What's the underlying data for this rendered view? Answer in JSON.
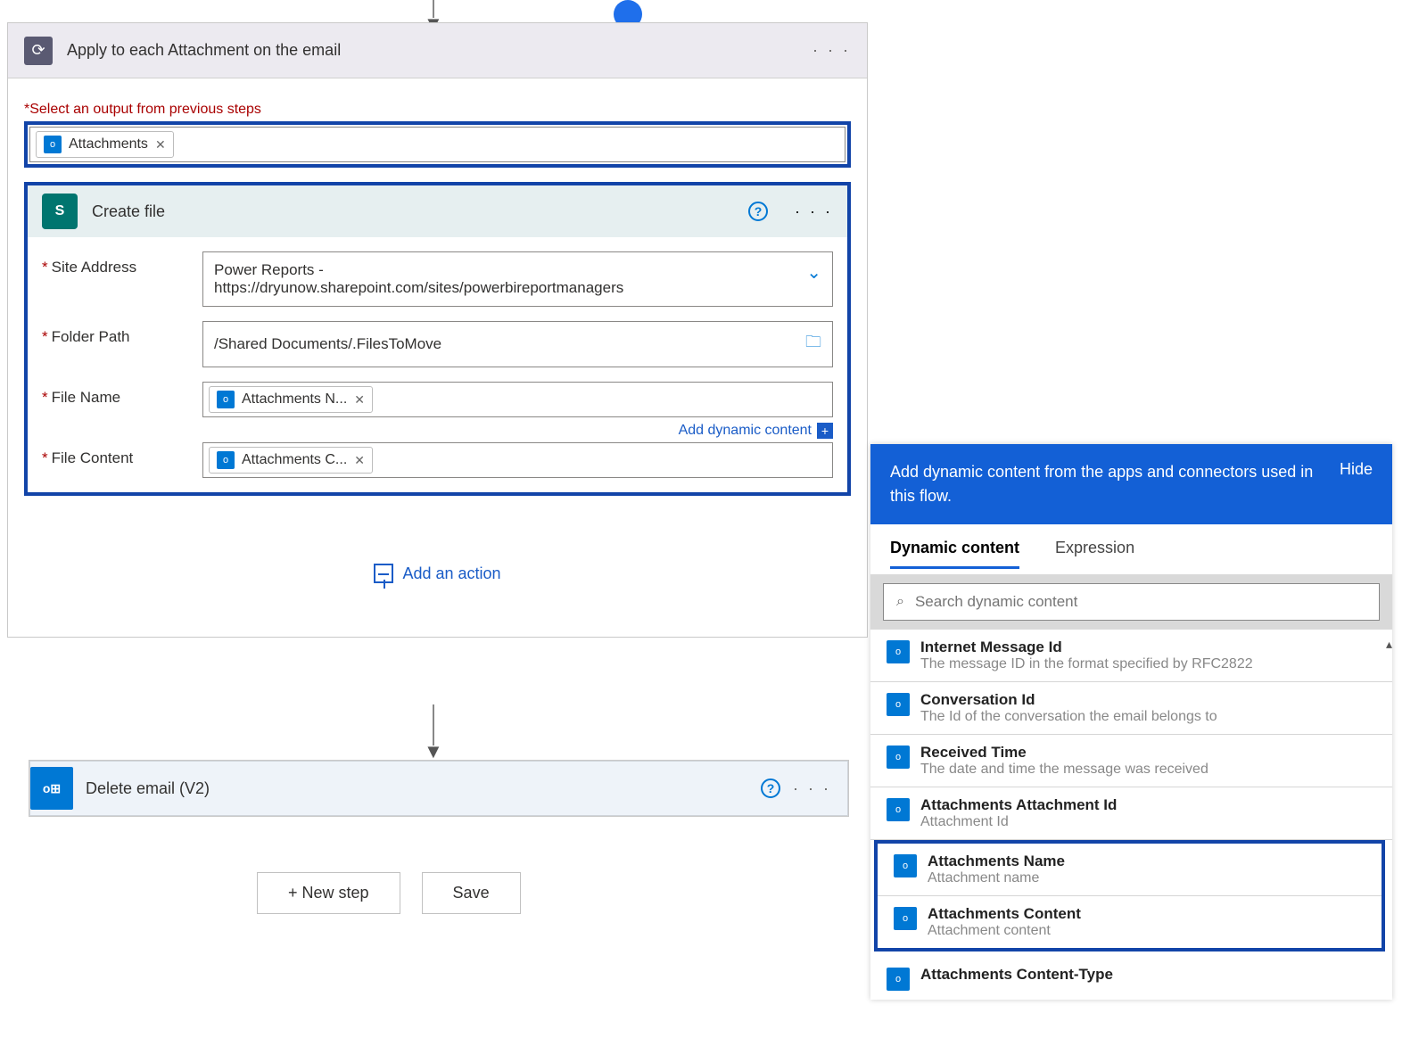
{
  "top_arrow": "↓",
  "apply_each": {
    "title": "Apply to each Attachment on the email",
    "select_label": "Select an output from previous steps",
    "token": "Attachments"
  },
  "create_file": {
    "title": "Create file",
    "fields": {
      "site_label": "Site Address",
      "site_value_line1": "Power Reports -",
      "site_value_line2": "https://dryunow.sharepoint.com/sites/powerbireportmanagers",
      "folder_label": "Folder Path",
      "folder_value": "/Shared Documents/.FilesToMove",
      "filename_label": "File Name",
      "filename_token": "Attachments N...",
      "filecontent_label": "File Content",
      "filecontent_token": "Attachments C..."
    },
    "add_dynamic_link": "Add dynamic content"
  },
  "add_action": "Add an action",
  "delete_email": {
    "title": "Delete email (V2)"
  },
  "footer": {
    "new_step": "+ New step",
    "save": "Save"
  },
  "dynamic_panel": {
    "header_text": "Add dynamic content from the apps and connectors used in this flow.",
    "hide": "Hide",
    "tabs": {
      "dynamic": "Dynamic content",
      "expression": "Expression"
    },
    "search_placeholder": "Search dynamic content",
    "items": [
      {
        "name": "Internet Message Id",
        "desc": "The message ID in the format specified by RFC2822"
      },
      {
        "name": "Conversation Id",
        "desc": "The Id of the conversation the email belongs to"
      },
      {
        "name": "Received Time",
        "desc": "The date and time the message was received"
      },
      {
        "name": "Attachments Attachment Id",
        "desc": "Attachment Id"
      },
      {
        "name": "Attachments Name",
        "desc": "Attachment name"
      },
      {
        "name": "Attachments Content",
        "desc": "Attachment content"
      },
      {
        "name": "Attachments Content-Type",
        "desc": ""
      }
    ]
  }
}
